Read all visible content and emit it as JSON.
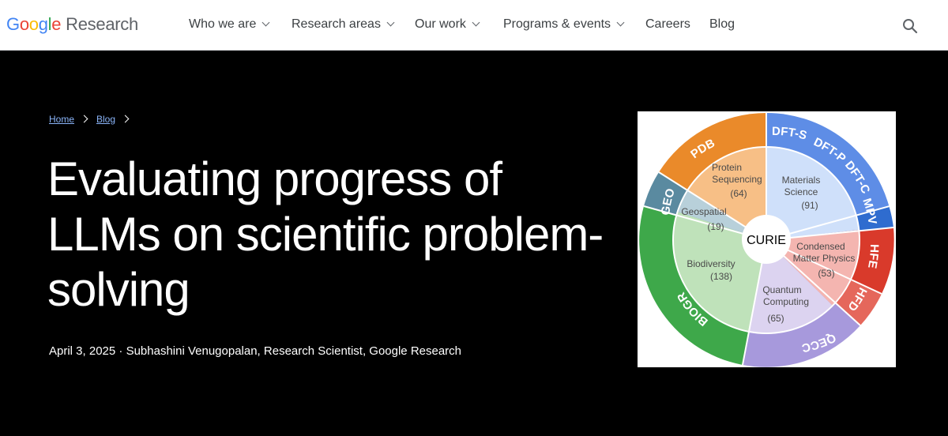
{
  "header": {
    "logo": {
      "part1": "G",
      "part2": "o",
      "part3": "o",
      "part4": "g",
      "part5": "l",
      "part6": "e",
      "product": "Research"
    },
    "nav": [
      {
        "label": "Who we are",
        "dropdown": true
      },
      {
        "label": "Research areas",
        "dropdown": true
      },
      {
        "label": "Our work",
        "dropdown": true
      },
      {
        "label": "Programs & events",
        "dropdown": true
      },
      {
        "label": "Careers",
        "dropdown": false
      },
      {
        "label": "Blog",
        "dropdown": false
      }
    ],
    "search_icon": "search-icon"
  },
  "breadcrumb": {
    "home": "Home",
    "blog": "Blog"
  },
  "article": {
    "title": "Evaluating progress of LLMs on scientific problem-solving",
    "date": "April 3, 2025",
    "separator": "·",
    "author": "Subhashini Venugopalan, Research Scientist, Google Research"
  },
  "figure": {
    "center_label": "CURIE",
    "domains": [
      {
        "name": "Materials",
        "name2": "Science",
        "count": "(91)",
        "color": "#cfe0fa"
      },
      {
        "name": "Condensed",
        "name2": "Matter Physics",
        "count": "(53)",
        "color": "#f4b5b0"
      },
      {
        "name": "Quantum",
        "name2": "Computing",
        "count": "(65)",
        "color": "#dcd3f0"
      },
      {
        "name": "Biodiversity",
        "name2": "",
        "count": "(138)",
        "color": "#bfe2ba"
      },
      {
        "name": "Geospatial",
        "name2": "",
        "count": "(19)",
        "color": "#b8d0da"
      },
      {
        "name": "Protein",
        "name2": "Sequencing",
        "count": "(64)",
        "color": "#f7bf86"
      }
    ],
    "tasks": [
      {
        "label": "DFT-S",
        "color": "#5e8de6"
      },
      {
        "label": "DFT-P",
        "color": "#5e8de6"
      },
      {
        "label": "DFT-C",
        "color": "#5e8de6"
      },
      {
        "label": "MPV",
        "color": "#2f6ccf"
      },
      {
        "label": "HFE",
        "color": "#d93a2b"
      },
      {
        "label": "HFD",
        "color": "#e5675b"
      },
      {
        "label": "QECC",
        "color": "#a799dc"
      },
      {
        "label": "BIOGR",
        "color": "#3ea84a"
      },
      {
        "label": "GEO",
        "color": "#5a8aa0"
      },
      {
        "label": "PDB",
        "color": "#ea8a2a"
      }
    ]
  }
}
